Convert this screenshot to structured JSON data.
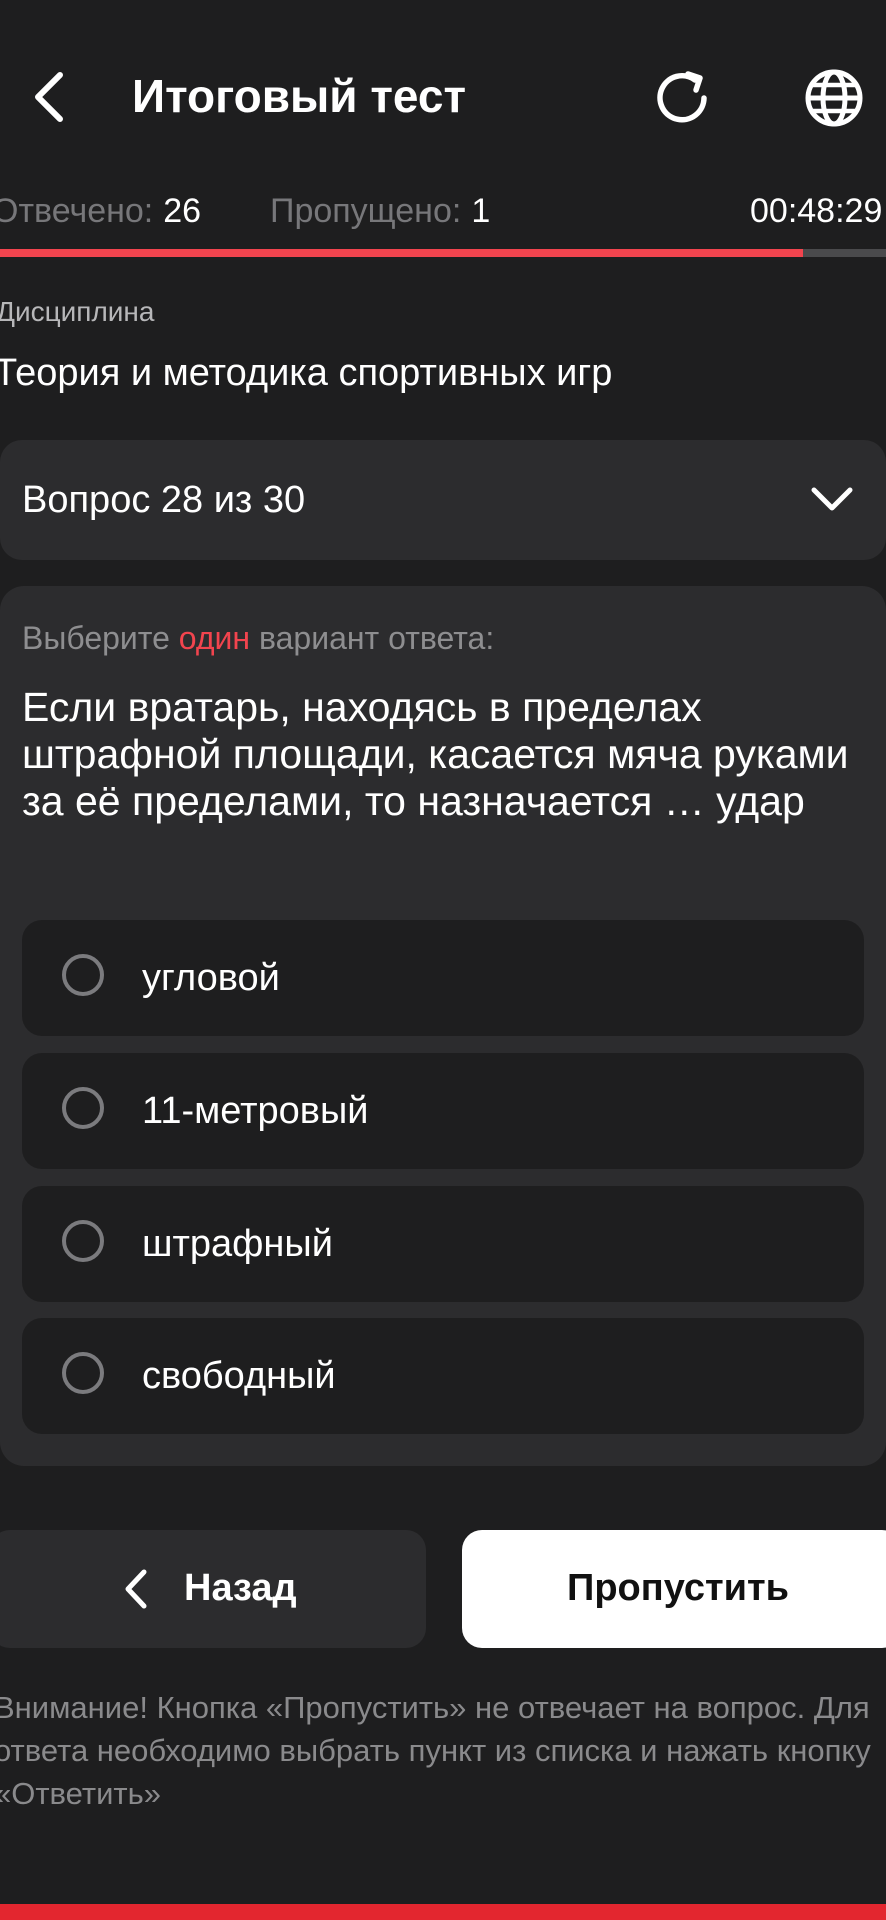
{
  "header": {
    "title": "Итоговый тест",
    "back_icon": "chevron-left-icon",
    "refresh_icon": "refresh-icon",
    "language_icon": "globe-icon"
  },
  "stats": {
    "answered_label": "Отвечено:",
    "answered_value": "26",
    "skipped_label": "Пропущено:",
    "skipped_value": "1",
    "timer": "00:48:29"
  },
  "progress": {
    "fraction": 0.906,
    "fill_color": "#f2444e",
    "track_color": "#4a4a4c"
  },
  "discipline": {
    "label": "Дисциплина",
    "name": "Теория и методика спортивных игр"
  },
  "question_selector": {
    "label": "Вопрос 28 из 30",
    "icon": "chevron-down-icon"
  },
  "question": {
    "instruction_before": "Выберите ",
    "instruction_accent": "один",
    "instruction_after": " вариант ответа:",
    "text": "Если вратарь, находясь в пределах штрафной площади, касается мяча руками за её пределами, то назначается … удар",
    "options": [
      {
        "label": "угловой"
      },
      {
        "label": "11-метровый"
      },
      {
        "label": "штрафный"
      },
      {
        "label": "свободный"
      }
    ]
  },
  "buttons": {
    "back_label": "Назад",
    "skip_label": "Пропустить"
  },
  "notice": "Внимание! Кнопка «Пропустить» не отвечает на вопрос. Для ответа необходимо выбрать пункт из списка и нажать кнопку «Ответить»",
  "colors": {
    "background": "#1e1e1f",
    "card": "#2c2c2e",
    "accent": "#f2444e"
  }
}
